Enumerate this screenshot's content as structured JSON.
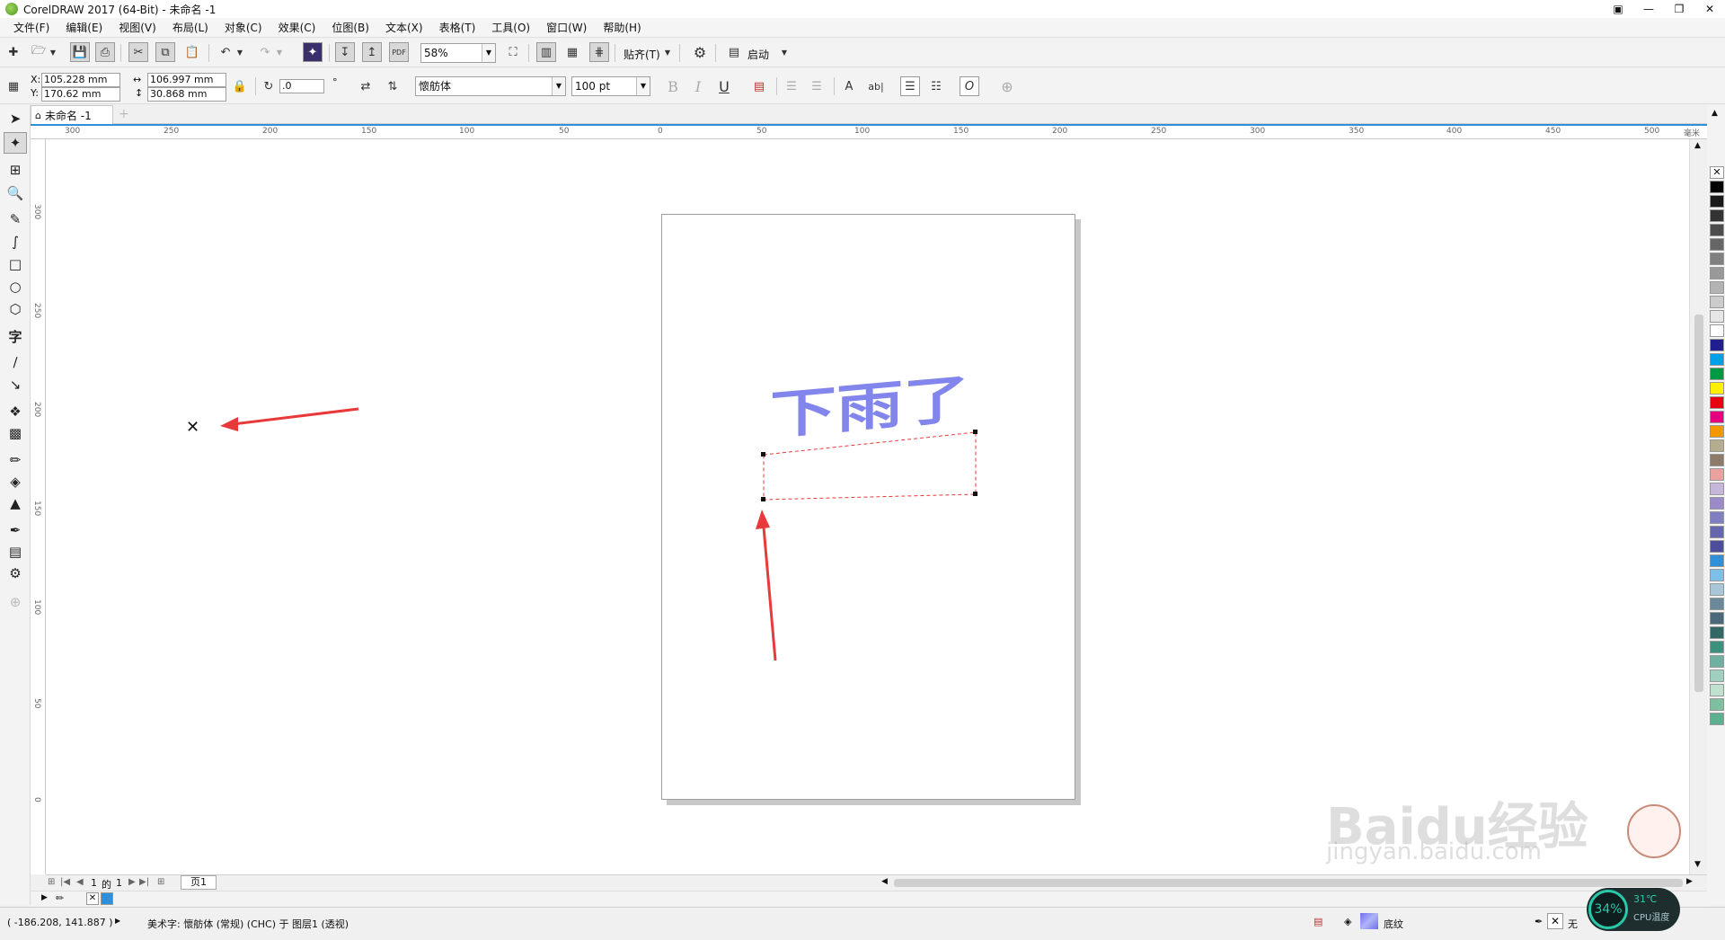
{
  "window": {
    "title": "CorelDRAW 2017 (64-Bit) - 未命名 -1"
  },
  "menubar": {
    "items": [
      "文件(F)",
      "编辑(E)",
      "视图(V)",
      "布局(L)",
      "对象(C)",
      "效果(C)",
      "位图(B)",
      "文本(X)",
      "表格(T)",
      "工具(O)",
      "窗口(W)",
      "帮助(H)"
    ]
  },
  "standard_toolbar": {
    "zoom_value": "58%",
    "snap_label": "贴齐(T)",
    "launch_label": "启动",
    "pdf_label": "PDF"
  },
  "property_bar": {
    "x_label": "X:",
    "x_value": "105.228 mm",
    "y_label": "Y:",
    "y_value": "170.62 mm",
    "width_value": "106.997 mm",
    "height_value": "30.868 mm",
    "rotation_value": ".0",
    "font_name": "懷舫体",
    "font_size": "100 pt",
    "bold_glyph": "B",
    "italic_glyph": "I",
    "underline_glyph": "U",
    "char_fmt_glyph": "A",
    "text_glyph": "ab|",
    "o_glyph": "O"
  },
  "document": {
    "tab_label": "未命名 -1",
    "artwork_text": "下雨了"
  },
  "rulers": {
    "horizontal_ticks": [
      "300",
      "250",
      "200",
      "150",
      "100",
      "50",
      "0",
      "50",
      "100",
      "150",
      "200",
      "250",
      "300",
      "350",
      "400",
      "450",
      "500"
    ],
    "horizontal_unit": "毫米",
    "vertical_ticks": [
      "300",
      "250",
      "200",
      "150",
      "100",
      "50",
      "0"
    ]
  },
  "page_nav": {
    "current": "1",
    "of_label": "的",
    "total": "1",
    "page_tab": "页1"
  },
  "statusbar": {
    "coords": "( -186.208, 141.887 )",
    "object_info": "美术字: 懷舫体 (常规) (CHC) 于 图层1 (透视)",
    "fill_label": "底纹",
    "outline_label": "无"
  },
  "cpu_widget": {
    "percent": "34%",
    "temp": "31℃",
    "label": "CPU温度"
  },
  "watermark": {
    "brand": "Baidu经验",
    "url": "jingyan.baidu.com"
  },
  "colors": {
    "ruler_accent": "#2f8fd8",
    "selection_red": "#e83a3a",
    "text_blue": "#5b60e0",
    "palette": [
      "#000000",
      "#1a1a1a",
      "#333333",
      "#4d4d4d",
      "#666666",
      "#808080",
      "#999999",
      "#b3b3b3",
      "#cccccc",
      "#e6e6e6",
      "#ffffff",
      "#1f1f8f",
      "#00a0e9",
      "#009944",
      "#fff100",
      "#e60012",
      "#e4007f",
      "#f39800",
      "#b5ad8f",
      "#8c7b6b",
      "#e8a2a0",
      "#c6b6d8",
      "#9b8bc8",
      "#8080c0",
      "#6666aa",
      "#4d4d99",
      "#2f8fd8",
      "#7fbfe8",
      "#a8c8d8",
      "#6a8a9a",
      "#4a6a7a",
      "#336666",
      "#3f8f7f",
      "#6fb0a0",
      "#9fd0c0",
      "#c0e0d0",
      "#7fbf9f",
      "#5fae8f"
    ]
  }
}
